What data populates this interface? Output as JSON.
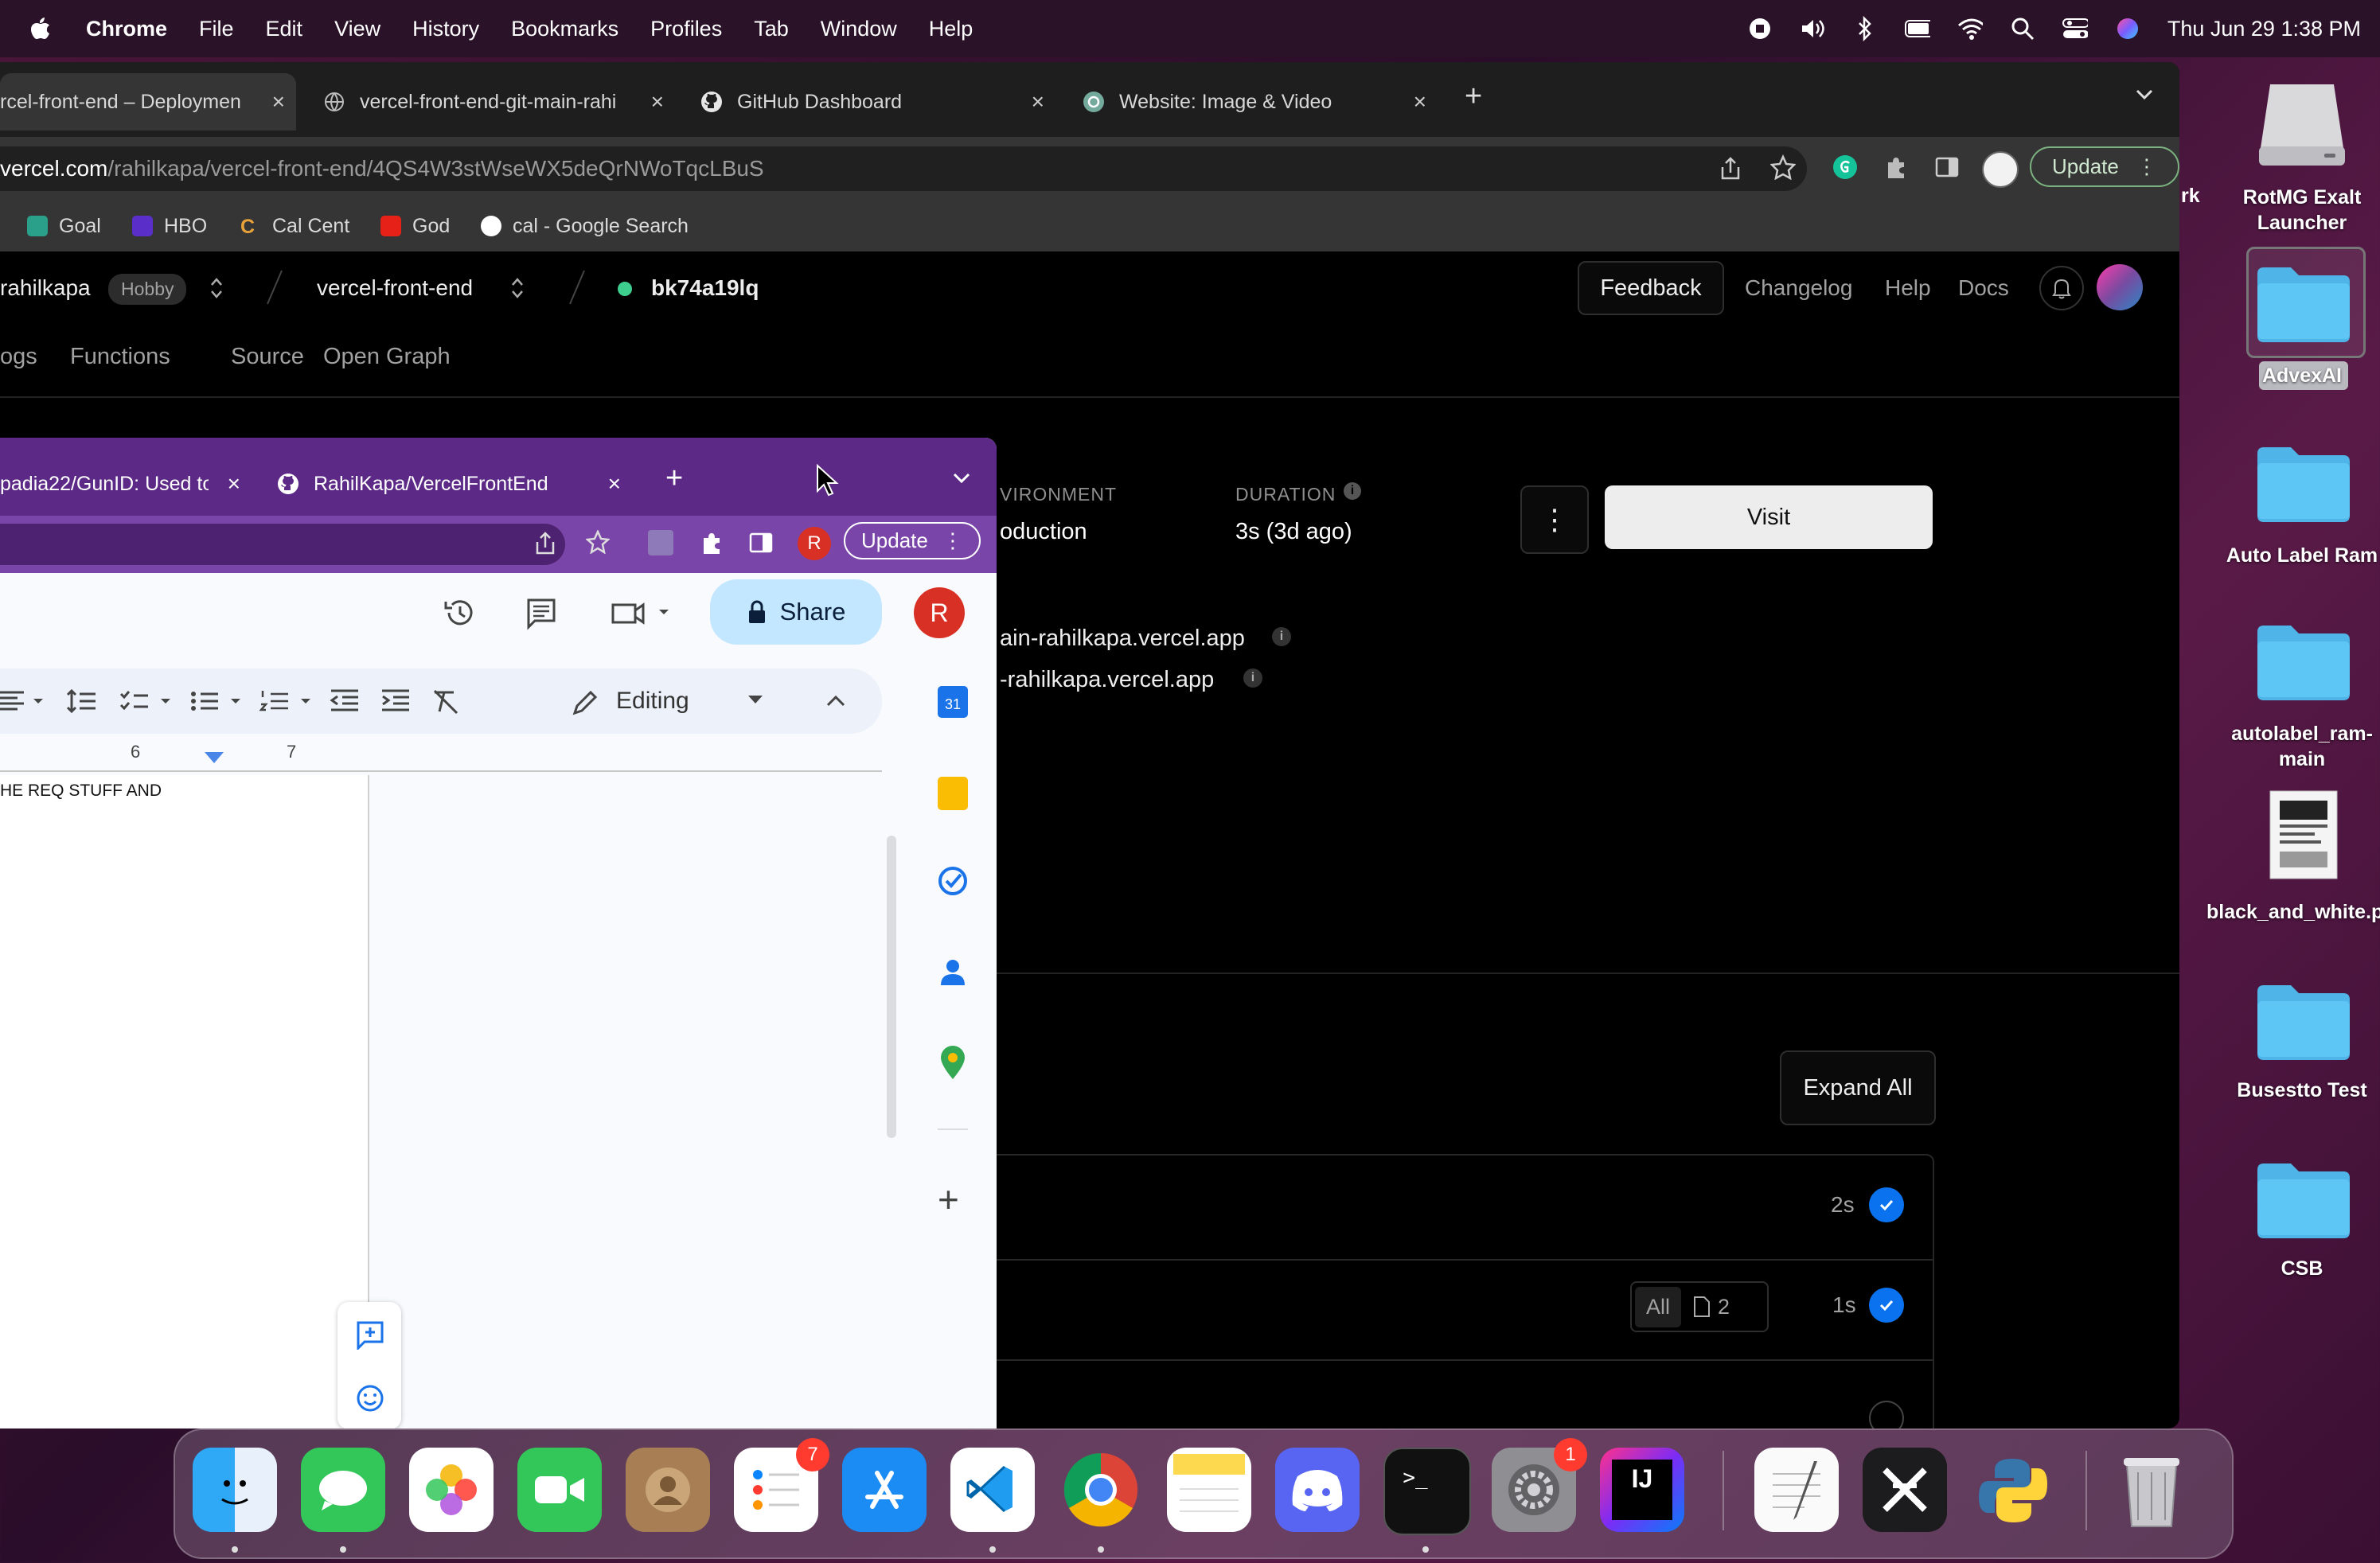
{
  "menubar": {
    "app_name": "Chrome",
    "items": [
      "File",
      "Edit",
      "View",
      "History",
      "Bookmarks",
      "Profiles",
      "Tab",
      "Window",
      "Help"
    ],
    "clock": "Thu Jun 29  1:38 PM"
  },
  "browser_main": {
    "tabs": [
      {
        "title": "rcel-front-end – Deploymen",
        "icon": "vercel-icon"
      },
      {
        "title": "vercel-front-end-git-main-rahi",
        "icon": "globe-icon"
      },
      {
        "title": "GitHub Dashboard",
        "icon": "github-icon"
      },
      {
        "title": "Website: Image & Video",
        "icon": "openai-icon"
      }
    ],
    "url_host": "vercel.com",
    "url_path": "/rahilkapa/vercel-front-end/4QS4W3stWseWX5deQrNWoTqcLBuS",
    "update_label": "Update",
    "bookmarks": [
      "Goal",
      "HBO",
      "Cal Cent",
      "God",
      "cal - Google Search"
    ]
  },
  "vercel": {
    "team": "rahilkapa",
    "plan": "Hobby",
    "project": "vercel-front-end",
    "deployment": "bk74a19lq",
    "nav_right": [
      "Feedback",
      "Changelog",
      "Help",
      "Docs"
    ],
    "tabs": [
      "ogs",
      "Functions",
      "Source",
      "Open Graph"
    ],
    "environment_label": "VIRONMENT",
    "environment_value": "oduction",
    "duration_label": "DURATION",
    "duration_value": "3s (3d ago)",
    "visit_label": "Visit",
    "domains": [
      "ain-rahilkapa.vercel.app",
      "-rahilkapa.vercel.app"
    ],
    "expand_all_label": "Expand All",
    "steps": [
      {
        "time": "2s",
        "status": "done"
      },
      {
        "time": "1s",
        "status": "done",
        "filter_all": "All",
        "files": "2"
      },
      {
        "time": "",
        "status": "pending"
      }
    ]
  },
  "browser_docs": {
    "tabs": [
      {
        "title": "padia22/GunID: Used to",
        "icon": "doc-icon"
      },
      {
        "title": "RahilKapa/VercelFrontEnd",
        "icon": "github-icon"
      }
    ],
    "update_label": "Update",
    "profile_initial": "R",
    "share_label": "Share",
    "editing_label": "Editing",
    "ruler": [
      "6",
      "7"
    ],
    "doc_text": "HE REQ STUFF AND"
  },
  "desktop": {
    "icons": [
      {
        "label": "RotMG Exalt Launcher",
        "type": "drive"
      },
      {
        "label": "AdvexAI",
        "type": "folder"
      },
      {
        "label": "Auto Label Ram",
        "type": "folder"
      },
      {
        "label": "autolabel_ram-main",
        "type": "folder"
      },
      {
        "label": "black_and_white.png",
        "type": "image"
      },
      {
        "label": "Busestto Test",
        "type": "folder"
      },
      {
        "label": "CSB",
        "type": "folder"
      }
    ],
    "partial_label": "rk"
  },
  "dock": {
    "apps": [
      "Finder",
      "Messages",
      "Photos",
      "FaceTime",
      "Contacts",
      "Reminders",
      "App Store",
      "Visual Studio Code",
      "Google Chrome",
      "Notes",
      "Discord",
      "Terminal",
      "System Settings",
      "IntelliJ IDEA",
      "TextEdit",
      "Final Cut",
      "Python Launcher",
      "Trash"
    ],
    "reminders_badge": "7",
    "settings_badge": "1"
  },
  "colors": {
    "vercel_bg": "#000000",
    "accent_blue": "#0a72ef",
    "docs_purple": "#5c2a86",
    "share_blue": "#c2e7ff"
  }
}
